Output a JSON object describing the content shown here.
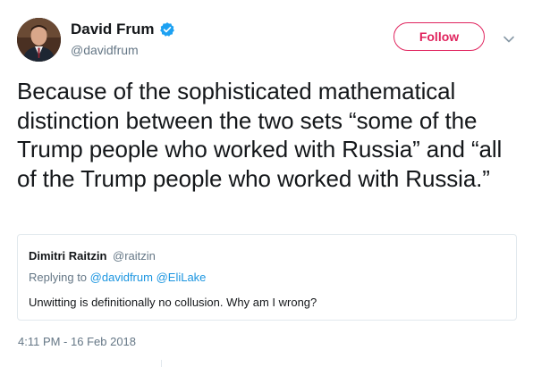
{
  "author": {
    "name": "David Frum",
    "handle": "@davidfrum",
    "verified": true
  },
  "actions": {
    "follow_label": "Follow"
  },
  "tweet": {
    "text": "Because of the sophisticated mathematical distinction between the two sets “some of the Trump people who worked with Russia” and “all of the Trump people who worked with Russia.”",
    "timestamp": "4:11 PM - 16 Feb 2018"
  },
  "quoted": {
    "name": "Dimitri Raitzin",
    "handle": "@raitzin",
    "replying_prefix": "Replying to",
    "replying_to": [
      "@davidfrum",
      "@EliLake"
    ],
    "text": "Unwitting is definitionally no collusion. Why am I wrong?"
  },
  "colors": {
    "follow_accent": "#e0245e",
    "verified_badge": "#1da1f2",
    "link": "#1b95e0",
    "secondary_text": "#657786",
    "border": "#e1e8ed"
  },
  "icons": {
    "verified": "verified-badge-icon",
    "menu": "chevron-down-icon"
  }
}
